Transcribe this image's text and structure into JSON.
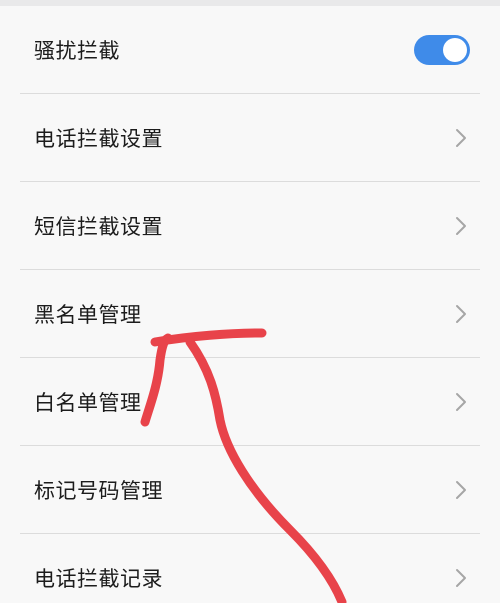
{
  "settings": {
    "rows": [
      {
        "label": "骚扰拦截",
        "control": "toggle",
        "toggle_on": true
      },
      {
        "label": "电话拦截设置",
        "control": "chevron"
      },
      {
        "label": "短信拦截设置",
        "control": "chevron"
      },
      {
        "label": "黑名单管理",
        "control": "chevron"
      },
      {
        "label": "白名单管理",
        "control": "chevron"
      },
      {
        "label": "标记号码管理",
        "control": "chevron"
      },
      {
        "label": "电话拦截记录",
        "control": "chevron"
      }
    ]
  },
  "colors": {
    "toggle_accent": "#3f8be9",
    "annotation_arrow": "#e8434a",
    "chevron": "#a6a6a6"
  },
  "icons": {
    "chevron": "chevron-right-icon",
    "toggle": "toggle-switch"
  }
}
